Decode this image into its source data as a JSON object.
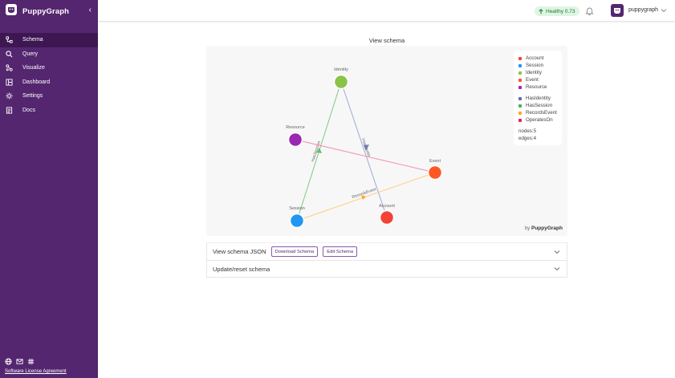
{
  "brand": {
    "name": "PuppyGraph"
  },
  "sidebar": {
    "items": [
      {
        "label": "Schema",
        "icon": "schema-icon",
        "active": true
      },
      {
        "label": "Query",
        "icon": "search-icon"
      },
      {
        "label": "Visualize",
        "icon": "visualize-icon"
      },
      {
        "label": "Dashboard",
        "icon": "dashboard-icon"
      },
      {
        "label": "Settings",
        "icon": "gear-icon"
      },
      {
        "label": "Docs",
        "icon": "docs-icon"
      }
    ],
    "bottom_icons": [
      "globe-icon",
      "mail-icon",
      "slack-icon"
    ],
    "license": "Software License Agreement"
  },
  "topbar": {
    "health_label": "Healthy 0.73",
    "health_color": "#1f7a35",
    "username": "puppygraph"
  },
  "main": {
    "title": "View schema",
    "byline_prefix": "by",
    "byline_brand": "PuppyGraph",
    "panels": [
      {
        "label": "View schema JSON",
        "buttons": [
          "Download Schema",
          "Edit Schema"
        ]
      },
      {
        "label": "Update/reset schema"
      }
    ]
  },
  "legend": {
    "vertices": [
      {
        "label": "Account",
        "color": "#f44336"
      },
      {
        "label": "Session",
        "color": "#2196f3"
      },
      {
        "label": "Identity",
        "color": "#8bc34a"
      },
      {
        "label": "Event",
        "color": "#ff5722"
      },
      {
        "label": "Resource",
        "color": "#9c27b0"
      }
    ],
    "edges": [
      {
        "label": "HasIdentity",
        "color": "#5c6bc0"
      },
      {
        "label": "HasSession",
        "color": "#4caf50"
      },
      {
        "label": "RecordsEvent",
        "color": "#ffa726"
      },
      {
        "label": "OperatesOn",
        "color": "#e91e63"
      }
    ],
    "nodes_stat": "nodes:5",
    "edges_stat": "edges:4"
  },
  "graph": {
    "nodes": [
      {
        "id": "Identity",
        "label": "Identity",
        "color": "#8bc34a"
      },
      {
        "id": "Resource",
        "label": "Resource",
        "color": "#9c27b0"
      },
      {
        "id": "Event",
        "label": "Event",
        "color": "#ff5722"
      },
      {
        "id": "Session",
        "label": "Session",
        "color": "#2196f3"
      },
      {
        "id": "Account",
        "label": "Account",
        "color": "#f44336"
      }
    ],
    "edges": [
      {
        "label": "HasIdentity",
        "color": "#9fa8da"
      },
      {
        "label": "HasSession",
        "color": "#81c784"
      },
      {
        "label": "RecordsEvent",
        "color": "#ffcc80"
      },
      {
        "label": "OperatesOn",
        "color": "#f48fb1"
      }
    ]
  }
}
